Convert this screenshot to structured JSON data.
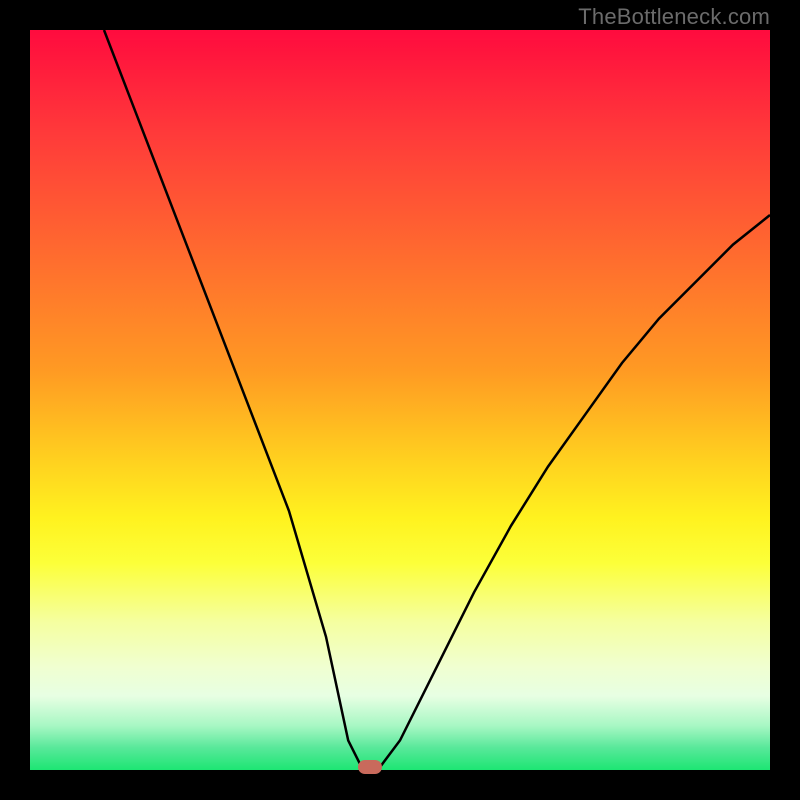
{
  "watermark": "TheBottleneck.com",
  "chart_data": {
    "type": "line",
    "title": "",
    "xlabel": "",
    "ylabel": "",
    "xlim": [
      0,
      100
    ],
    "ylim": [
      0,
      100
    ],
    "grid": false,
    "legend": false,
    "series": [
      {
        "name": "bottleneck-curve",
        "x": [
          10,
          15,
          20,
          25,
          30,
          35,
          40,
          43,
          45,
          47,
          50,
          55,
          60,
          65,
          70,
          75,
          80,
          85,
          90,
          95,
          100
        ],
        "y": [
          100,
          87,
          74,
          61,
          48,
          35,
          18,
          4,
          0,
          0,
          4,
          14,
          24,
          33,
          41,
          48,
          55,
          61,
          66,
          71,
          75
        ]
      }
    ],
    "marker": {
      "x": 46,
      "y": 0
    },
    "background_gradient": {
      "top": "#ff0b3e",
      "upper_mid": "#ffd01f",
      "lower_mid": "#f5ffa0",
      "bottom": "#1de673"
    }
  }
}
